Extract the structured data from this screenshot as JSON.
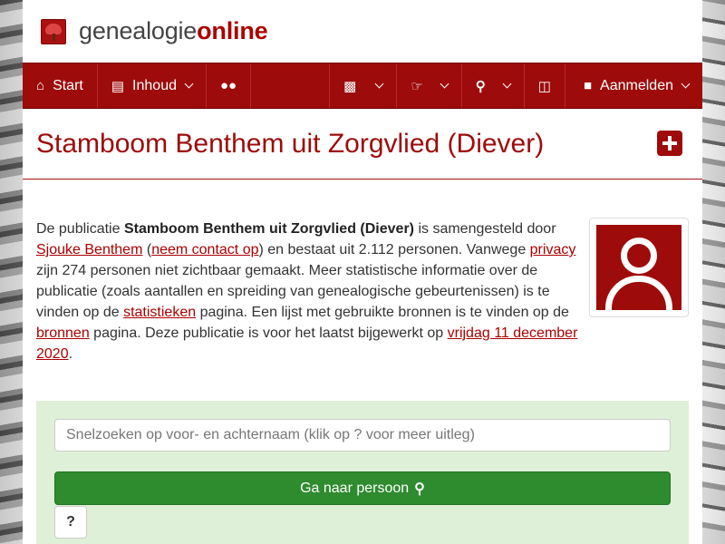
{
  "header": {
    "logo_regular": "genealogie",
    "logo_bold": "online"
  },
  "nav": {
    "start": "Start",
    "inhoud": "Inhoud",
    "aanmelden": "Aanmelden"
  },
  "page_title": "Stamboom Benthem uit Zorgvlied (Diever)",
  "intro": {
    "p1": "De publicatie ",
    "pub_name": "Stamboom Benthem uit Zorgvlied (Diever)",
    "p2": " is samengesteld door ",
    "author_link": "Sjouke Benthem",
    "p3": " (",
    "contact_link": "neem contact op",
    "p4": ") en bestaat uit 2.112 personen. Vanwege ",
    "privacy_link": "privacy",
    "p5": " zijn 274 personen niet zichtbaar gemaakt. Meer statistische informatie over de publicatie (zoals aantallen en spreiding van genealogische gebeurtenissen) is te vinden op de ",
    "stats_link": "statistieken",
    "p6": " pagina. Een lijst met gebruikte bronnen is te vinden op de ",
    "sources_link": "bronnen",
    "p7": " pagina. Deze publicatie is voor het laatst bijgewerkt op ",
    "date_link": "vrijdag 11 december 2020",
    "p8": "."
  },
  "search": {
    "placeholder": "Snelzoeken op voor- en achternaam (klik op ? voor meer uitleg)",
    "button_label": "Ga naar persoon",
    "help_label": "?"
  },
  "colors": {
    "brand": "#9e0b0b",
    "search_bg": "#dff0d8",
    "button": "#2e8b2e"
  }
}
